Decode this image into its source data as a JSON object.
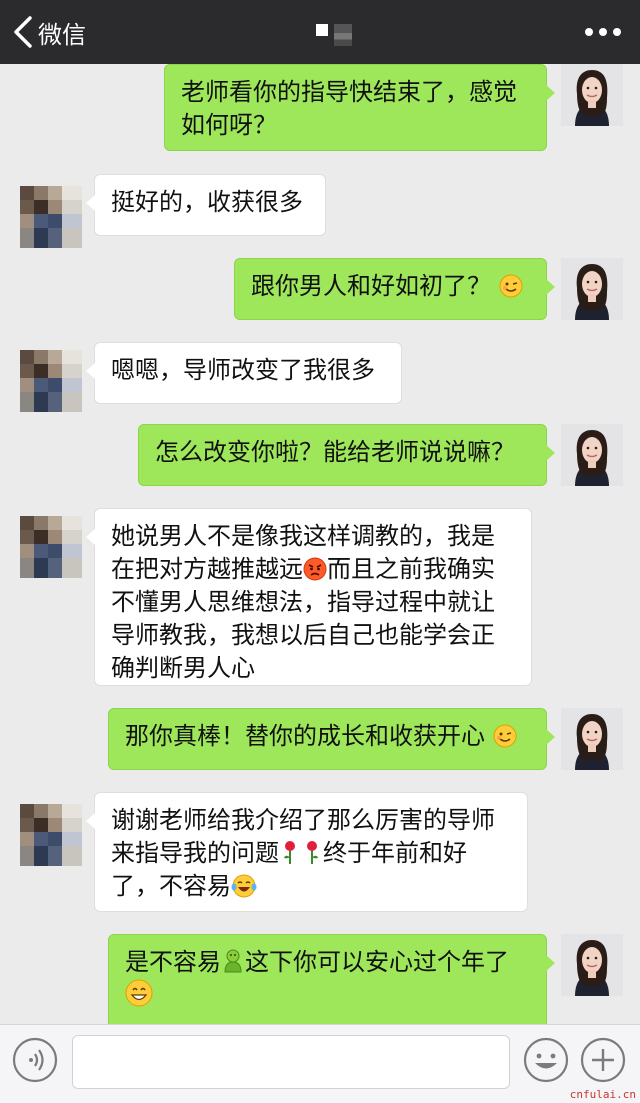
{
  "header": {
    "back_label": "微信",
    "more_icon": "more-dots-icon"
  },
  "messages": [
    {
      "from": "me",
      "text": "老师看你的指导快结束了，感觉如何呀？"
    },
    {
      "from": "peer",
      "text": "挺好的，收获很多"
    },
    {
      "from": "me",
      "text": "跟你男人和好如初了？",
      "emoji": "blush-wink-emoji"
    },
    {
      "from": "peer",
      "text": "嗯嗯，导师改变了我很多"
    },
    {
      "from": "me",
      "text": "怎么改变你啦？能给老师说说嘛？"
    },
    {
      "from": "peer",
      "text_before": "她说男人不是像我这样调教的，我是在把对方越推越远",
      "emoji": "angry-face-emoji",
      "text_after": "而且之前我确实不懂男人思维想法，指导过程中就让导师教我，我想以后自己也能学会正确判断男人心"
    },
    {
      "from": "me",
      "text": "那你真棒！替你的成长和收获开心",
      "emoji": "blush-wink-emoji"
    },
    {
      "from": "peer",
      "text_before": "谢谢老师给我介绍了那么厉害的导师来指导我的问题",
      "emoji": "rose-emoji",
      "text_after": "终于年前和好了，不容易",
      "emoji2": "laugh-tears-emoji"
    },
    {
      "from": "me",
      "text_before": "是不容易",
      "emoji": "green-figure-emoji",
      "text_after": "这下你可以安心过个年了",
      "emoji2": "grin-emoji"
    }
  ],
  "input": {
    "voice_icon": "voice-icon",
    "emoji_icon": "emoji-icon",
    "plus_icon": "plus-icon",
    "placeholder": ""
  },
  "watermark": "cnfulai.cn"
}
